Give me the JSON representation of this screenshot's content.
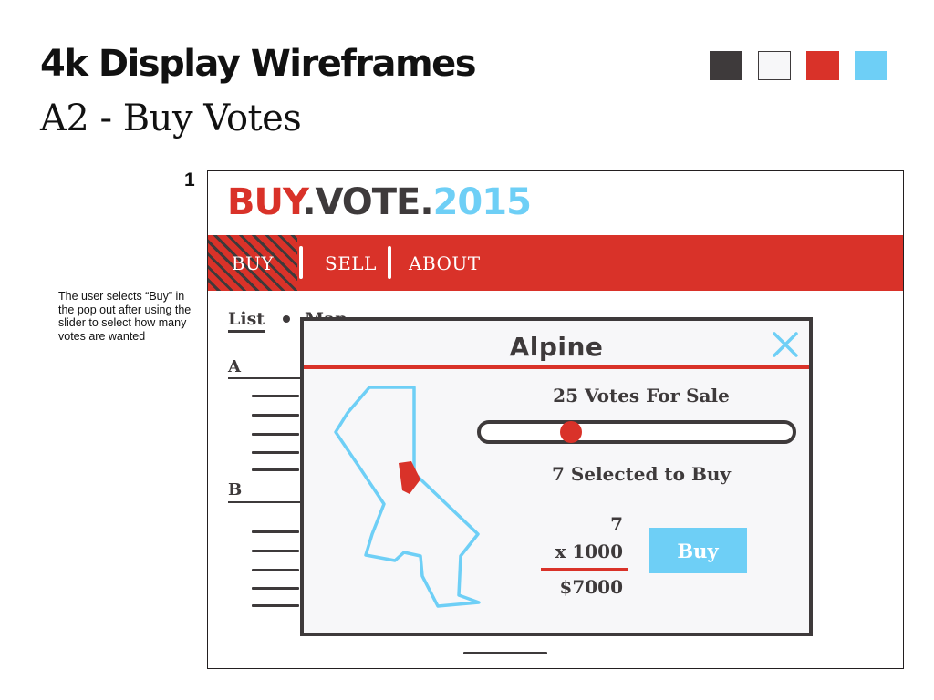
{
  "header": {
    "title": "4k Display Wireframes",
    "subtitle": "A2 - Buy Votes"
  },
  "palette": [
    "#3e3a3b",
    "#f7f7f9",
    "#d93229",
    "#6ecff6"
  ],
  "frame": {
    "number": "1",
    "annotation": "The user selects “Buy” in the pop out after using the slider to select how many votes are wanted"
  },
  "site": {
    "logo": {
      "part1": "BUY",
      "part2": ".VOTE.",
      "part3": "2015"
    },
    "nav": [
      {
        "label": "BUY",
        "active": true
      },
      {
        "label": "SELL"
      },
      {
        "label": "ABOUT"
      }
    ],
    "view_toggle": {
      "list": "List",
      "map": "Map",
      "active": "List"
    },
    "sections": [
      {
        "label": "A"
      },
      {
        "label": "B"
      }
    ]
  },
  "popup": {
    "title": "Alpine",
    "close_icon": "close-icon",
    "votes_for_sale": "25 Votes For Sale",
    "slider": {
      "min": 0,
      "max": 25,
      "value": 7
    },
    "selected": "7 Selected to Buy",
    "calc": {
      "quantity": "7",
      "multiplier": "x 1000",
      "total": "$7000"
    },
    "buy_label": "Buy",
    "map_icon": "california-map-icon"
  }
}
